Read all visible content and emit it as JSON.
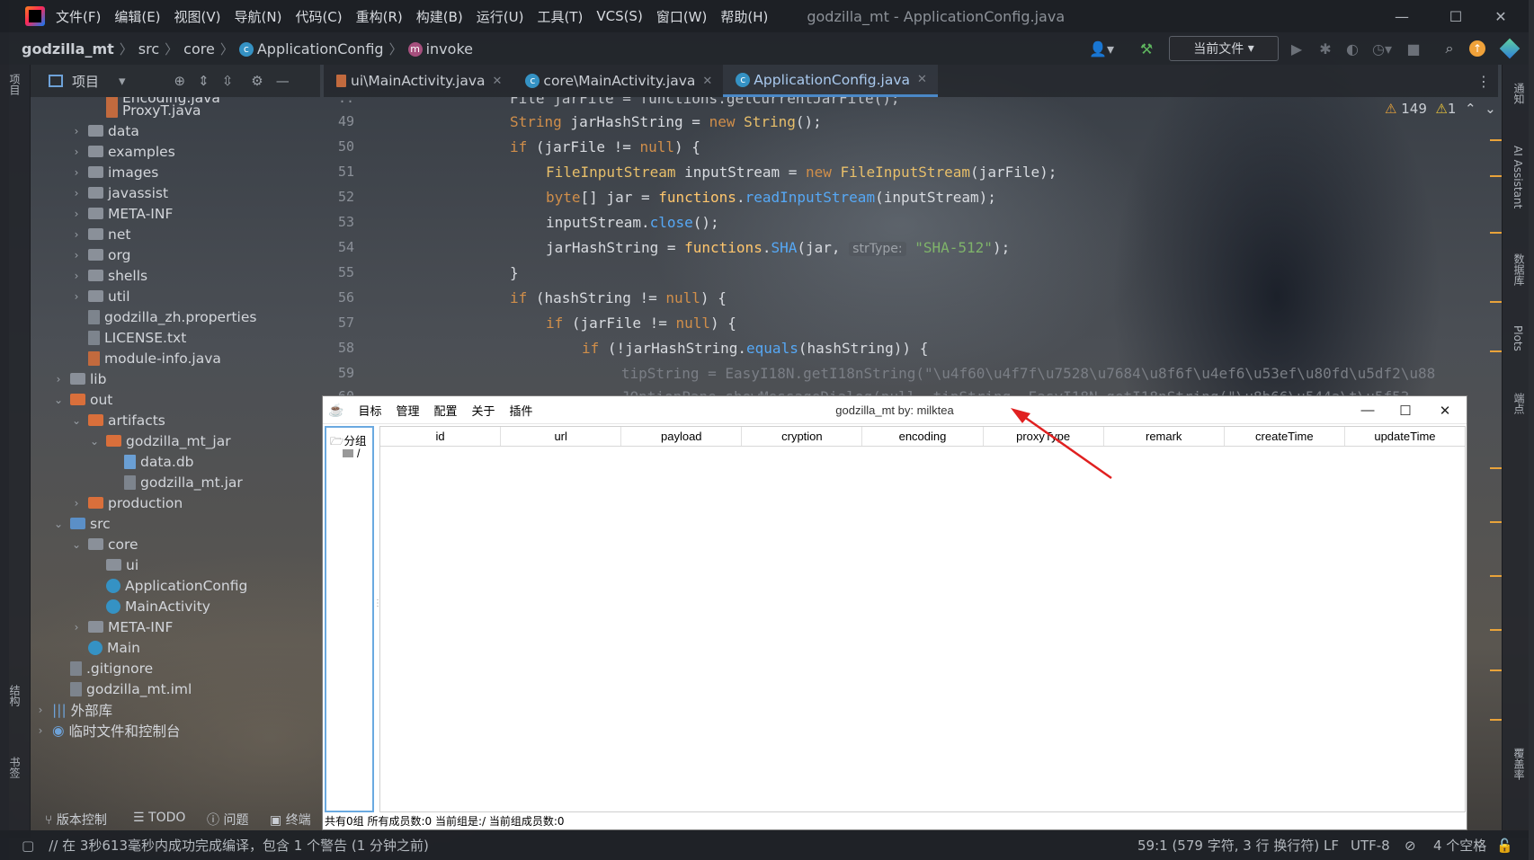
{
  "menubar": {
    "items": [
      "文件(F)",
      "编辑(E)",
      "视图(V)",
      "导航(N)",
      "代码(C)",
      "重构(R)",
      "构建(B)",
      "运行(U)",
      "工具(T)",
      "VCS(S)",
      "窗口(W)",
      "帮助(H)"
    ],
    "title": "godzilla_mt - ApplicationConfig.java"
  },
  "navbar": {
    "project": "godzilla_mt",
    "crumbs": [
      "src",
      "core"
    ],
    "class_name": "ApplicationConfig",
    "method_name": "invoke",
    "run_config": "当前文件"
  },
  "project_panel": {
    "title": "项目",
    "nodes": [
      {
        "label": "Encoding.java"
      },
      {
        "label": "ProxyT.java"
      },
      {
        "label": "data"
      },
      {
        "label": "examples"
      },
      {
        "label": "images"
      },
      {
        "label": "javassist"
      },
      {
        "label": "META-INF"
      },
      {
        "label": "net"
      },
      {
        "label": "org"
      },
      {
        "label": "shells"
      },
      {
        "label": "util"
      },
      {
        "label": "godzilla_zh.properties"
      },
      {
        "label": "LICENSE.txt"
      },
      {
        "label": "module-info.java"
      },
      {
        "label": "lib"
      },
      {
        "label": "out"
      },
      {
        "label": "artifacts"
      },
      {
        "label": "godzilla_mt_jar"
      },
      {
        "label": "data.db"
      },
      {
        "label": "godzilla_mt.jar"
      },
      {
        "label": "production"
      },
      {
        "label": "src"
      },
      {
        "label": "core"
      },
      {
        "label": "ui"
      },
      {
        "label": "ApplicationConfig"
      },
      {
        "label": "MainActivity"
      },
      {
        "label": "META-INF"
      },
      {
        "label": "Main"
      },
      {
        "label": ".gitignore"
      },
      {
        "label": "godzilla_mt.iml"
      },
      {
        "label": "外部库"
      },
      {
        "label": "临时文件和控制台"
      }
    ]
  },
  "editor_tabs": [
    {
      "label": "ui\\MainActivity.java"
    },
    {
      "label": "core\\MainActivity.java"
    },
    {
      "label": "ApplicationConfig.java"
    }
  ],
  "editor": {
    "line_numbers": [
      "49",
      "50",
      "51",
      "52",
      "53",
      "54",
      "55",
      "56",
      "57",
      "58",
      "59",
      "60"
    ],
    "warnings": "149",
    "weak_warnings": "1",
    "param_hint": "strType:"
  },
  "left_strip": {
    "project": "项目",
    "structure": "结构",
    "bookmarks": "书签"
  },
  "right_strip": {
    "notifications": "通知",
    "ai": "AI Assistant",
    "database": "数据库",
    "plots": "Plots",
    "endpoints": "端点",
    "coverage": "覆盖率"
  },
  "dialog": {
    "menus": [
      "目标",
      "管理",
      "配置",
      "关于",
      "插件"
    ],
    "title": "godzilla_mt by: milktea",
    "group_root": "分组",
    "group_child": "/",
    "columns": [
      "id",
      "url",
      "payload",
      "cryption",
      "encoding",
      "proxyType",
      "remark",
      "createTime",
      "updateTime"
    ],
    "status": "共有0组 所有成员数:0 当前组是:/ 当前组成员数:0"
  },
  "bottom_tools": [
    "版本控制",
    "TODO",
    "问题",
    "终端"
  ],
  "statusbar": {
    "message": "// 在 3秒613毫秒内成功完成编译，包含 1 个警告 (1 分钟之前)",
    "position": "59:1 (579 字符, 3 行 换行符)",
    "line_sep": "LF",
    "encoding": "UTF-8",
    "indent": "4 个空格"
  }
}
